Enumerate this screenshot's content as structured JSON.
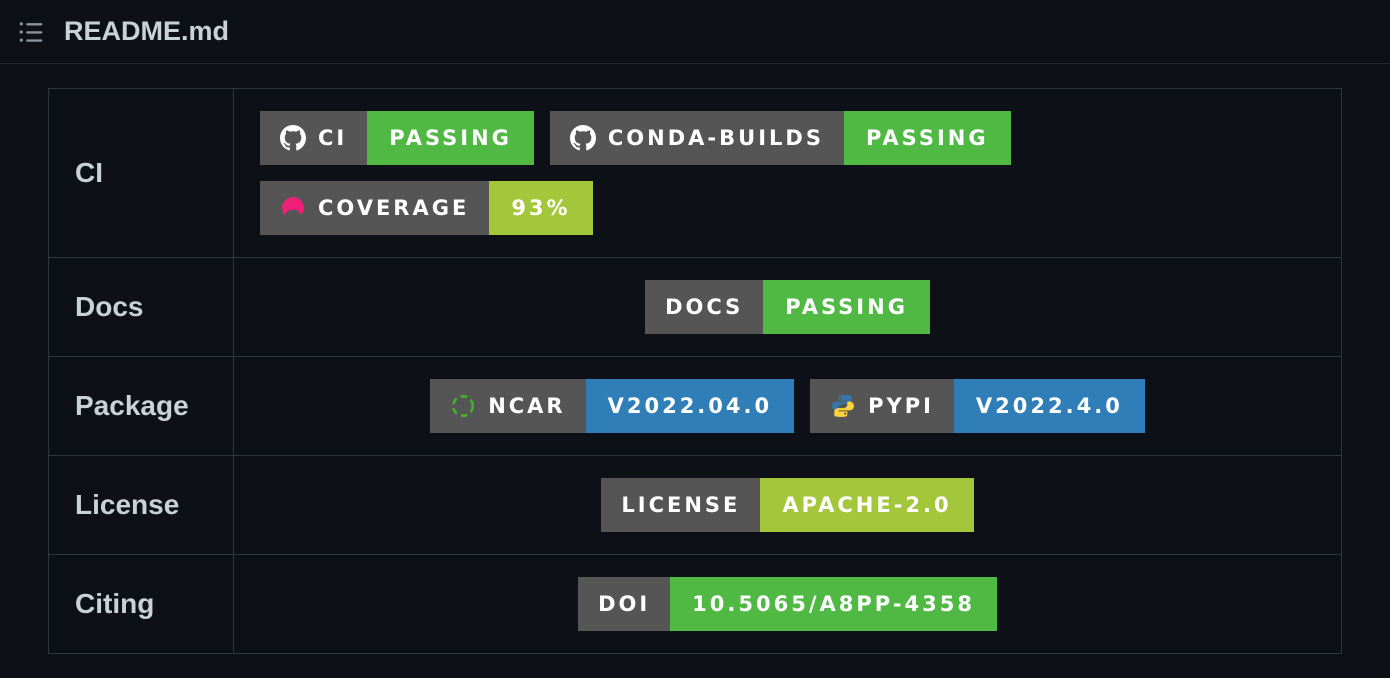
{
  "header": {
    "filename": "README.md"
  },
  "rows": {
    "ci": {
      "label": "CI",
      "badges": [
        {
          "left": "CI",
          "right": "PASSING",
          "icon": "github"
        },
        {
          "left": "CONDA-BUILDS",
          "right": "PASSING",
          "icon": "github"
        },
        {
          "left": "COVERAGE",
          "right": "93%",
          "icon": "codecov"
        }
      ]
    },
    "docs": {
      "label": "Docs",
      "badges": [
        {
          "left": "DOCS",
          "right": "PASSING"
        }
      ]
    },
    "package": {
      "label": "Package",
      "badges": [
        {
          "left": "NCAR",
          "right": "V2022.04.0",
          "icon": "conda"
        },
        {
          "left": "PYPI",
          "right": "V2022.4.0",
          "icon": "python"
        }
      ]
    },
    "license": {
      "label": "License",
      "badges": [
        {
          "left": "LICENSE",
          "right": "APACHE-2.0"
        }
      ]
    },
    "citing": {
      "label": "Citing",
      "badges": [
        {
          "left": "DOI",
          "right": "10.5065/A8PP-4358"
        }
      ]
    }
  }
}
